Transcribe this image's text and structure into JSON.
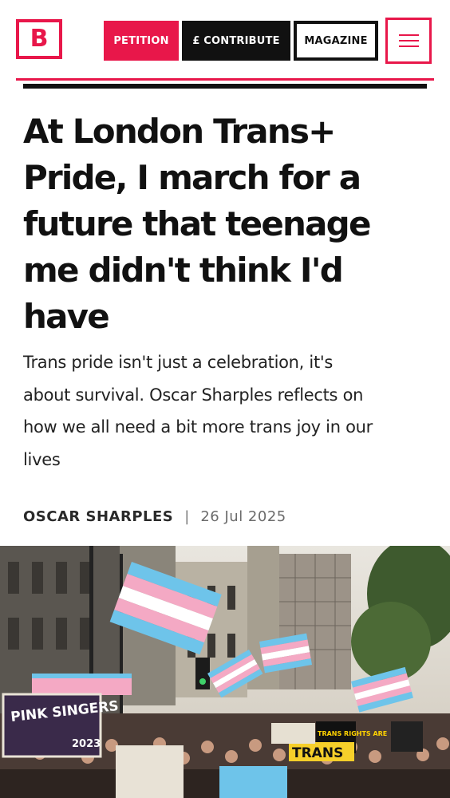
{
  "header": {
    "logo_letter": "B",
    "petition_label": "PETITION",
    "contribute_label": "£ CONTRIBUTE",
    "magazine_label": "MAGAZINE",
    "menu_icon": "hamburger-menu-icon"
  },
  "article": {
    "headline_lines": [
      "At London Trans+",
      "Pride, I march for a",
      "future that teenage",
      "me didn't think I'd",
      "have"
    ],
    "standfirst_lines": [
      "Trans pride isn't just a celebration, it's",
      "about survival. Oscar Sharples reflects on",
      "how we all need a bit more trans joy in our",
      "lives"
    ],
    "author": "OSCAR SHARPLES",
    "separator": "|",
    "date": "26 Jul 2025"
  },
  "hero_image": {
    "signs": {
      "pink_singers": "PINK SINGERS",
      "year": "2023",
      "trans_rights": "TRANS RIGHTS ARE",
      "trans": "TRANS"
    }
  },
  "colors": {
    "accent": "#e8174a",
    "dark": "#111111"
  }
}
